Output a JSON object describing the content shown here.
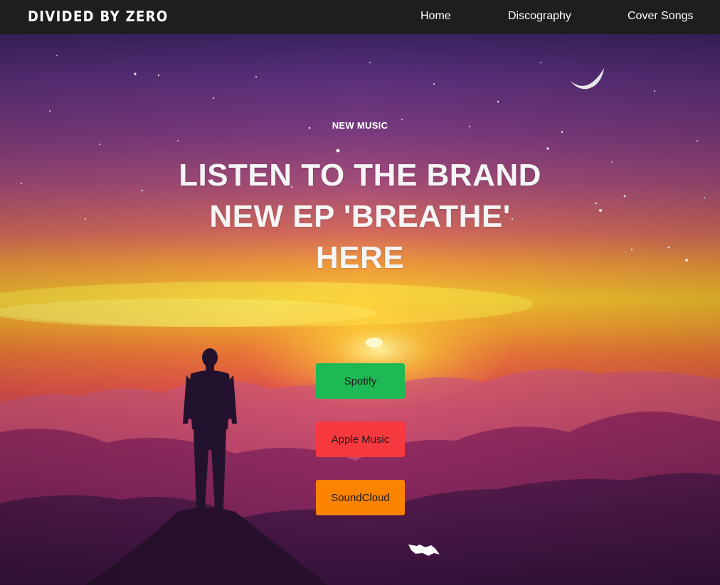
{
  "nav": {
    "brand": "DIVIDED BY ZERO",
    "links": [
      "Home",
      "Discography",
      "Cover Songs"
    ]
  },
  "hero": {
    "eyebrow": "NEW MUSIC",
    "headline": "LISTEN TO THE BRAND NEW EP 'BREATHE' HERE",
    "buttons": [
      {
        "label": "Spotify",
        "color": "#1db954"
      },
      {
        "label": "Apple Music",
        "color": "#f5393f"
      },
      {
        "label": "SoundCloud",
        "color": "#fb8300"
      }
    ],
    "background": "sunset-mountain-silhouette-image"
  },
  "icons": {
    "moon": "crescent-moon-icon",
    "scroll": "scroll-down-icon"
  }
}
